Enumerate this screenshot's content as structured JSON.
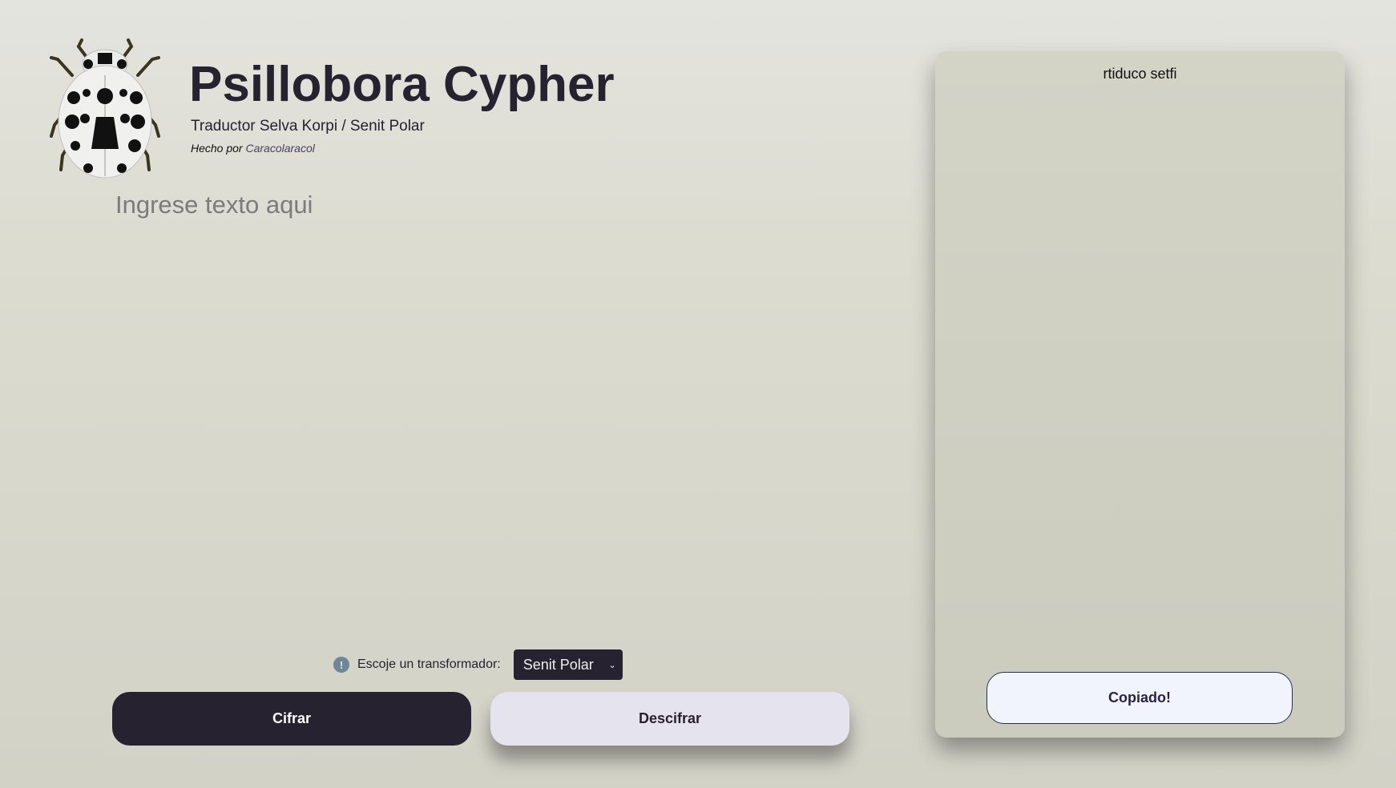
{
  "header": {
    "title": "Psillobora Cypher",
    "subtitle": "Traductor Selva Korpi / Senit Polar",
    "credit_prefix": "Hecho por",
    "credit_author": "Caracolaracol"
  },
  "editor": {
    "placeholder": "Ingrese texto aqui",
    "value": ""
  },
  "transformer": {
    "label": "Escoje un transformador:",
    "selected": "Senit Polar",
    "info_icon": "!"
  },
  "actions": {
    "encrypt_label": "Cifrar",
    "decrypt_label": "Descifrar"
  },
  "output": {
    "text": "rtiduco setfi",
    "copy_label": "Copiado!"
  }
}
